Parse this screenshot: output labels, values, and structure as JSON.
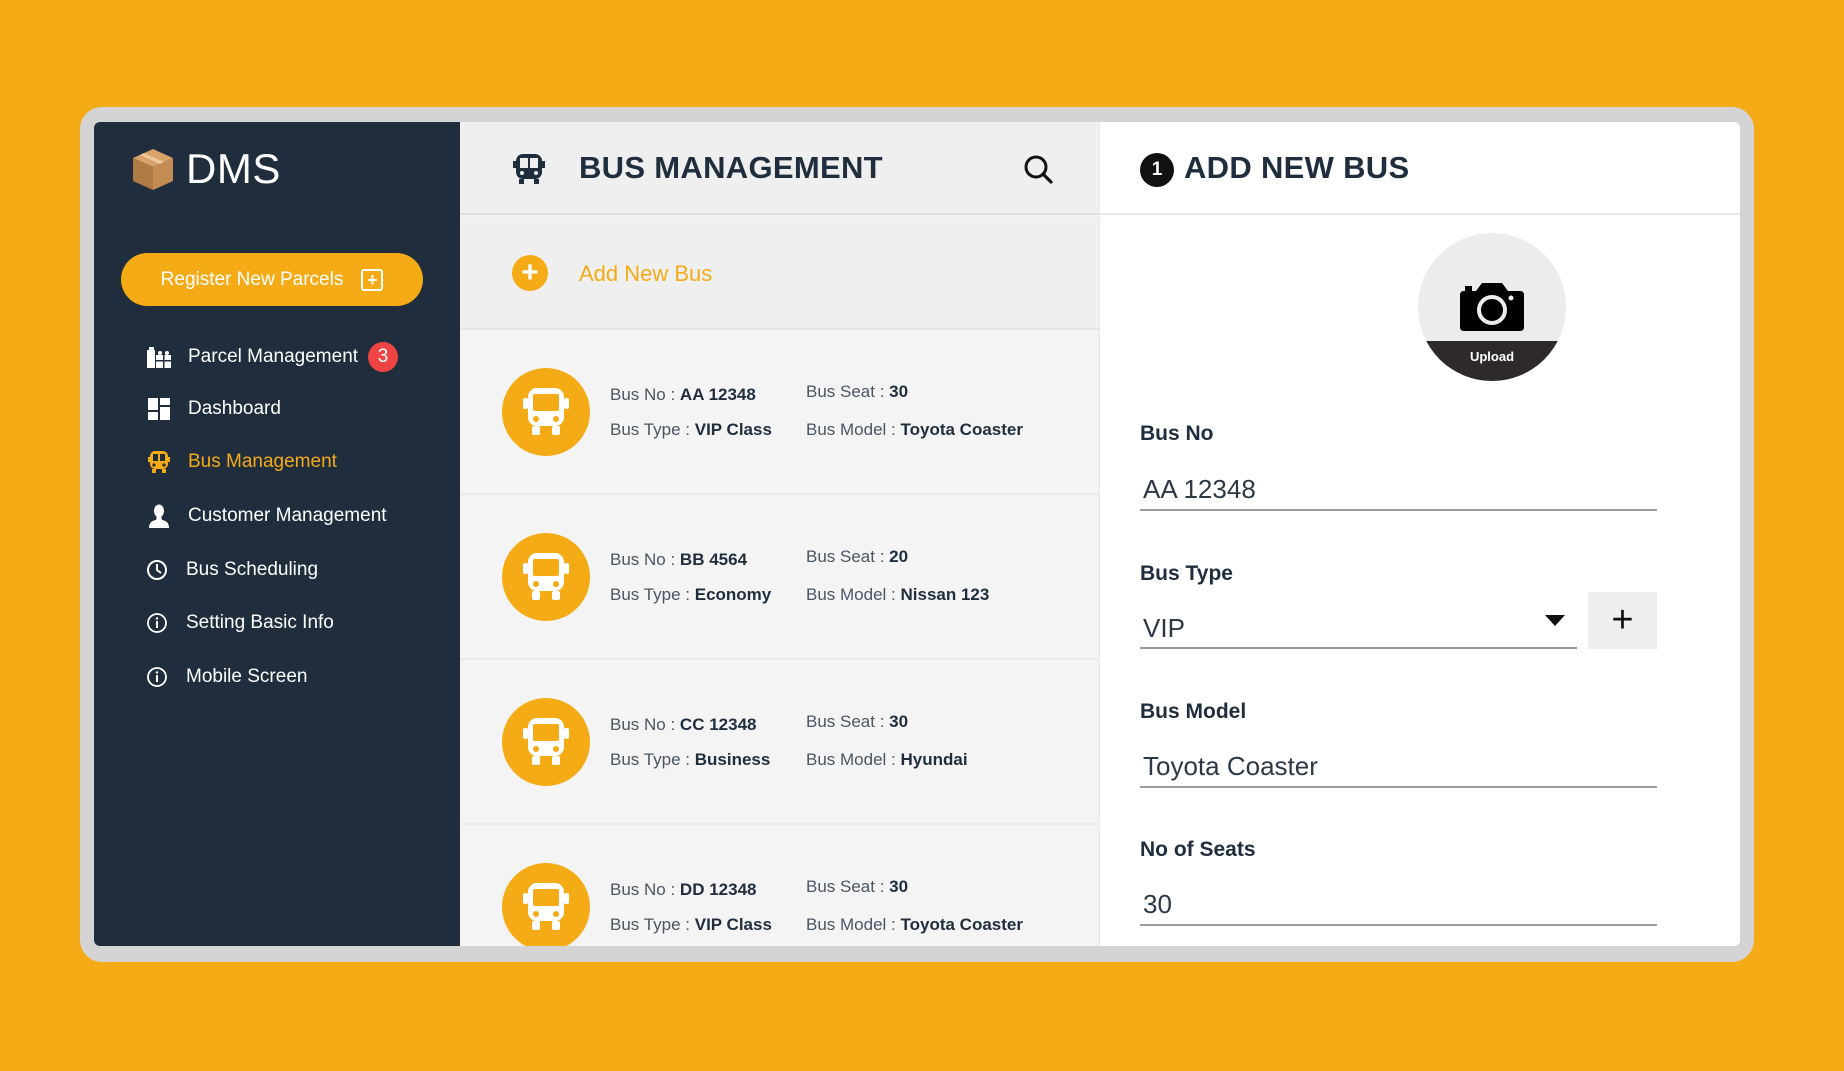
{
  "colors": {
    "accent": "#f5ab16",
    "sidebar_bg": "#1f2d3d",
    "badge": "#ef4444",
    "heading": "#1f2d3d"
  },
  "sidebar": {
    "logo_icon": "package-box-icon",
    "logo_text": "DMS",
    "register_button": {
      "label": "Register New Parcels",
      "icon": "plus-square-icon"
    },
    "items": [
      {
        "label": "Parcel Management",
        "icon": "parcel-icon",
        "badge": "3",
        "active": false
      },
      {
        "label": "Dashboard",
        "icon": "dashboard-icon",
        "active": false
      },
      {
        "label": "Bus Management",
        "icon": "bus-icon",
        "active": true
      },
      {
        "label": "Customer Management",
        "icon": "user-icon",
        "active": false
      },
      {
        "label": "Bus Scheduling",
        "icon": "clock-icon",
        "active": false
      },
      {
        "label": "Setting Basic Info",
        "icon": "info-icon",
        "active": false
      },
      {
        "label": "Mobile Screen",
        "icon": "info-icon",
        "active": false
      }
    ]
  },
  "middle": {
    "header": {
      "title": "BUS MANAGEMENT",
      "icon": "bus-icon",
      "search_icon": "search-icon"
    },
    "add_new": {
      "label": "Add New Bus",
      "icon": "plus-circle-icon"
    },
    "field_labels": {
      "bus_no": "Bus No : ",
      "bus_type": "Bus Type : ",
      "bus_seat": "Bus Seat : ",
      "bus_model": "Bus Model : "
    },
    "buses": [
      {
        "bus_no": "AA 12348",
        "bus_type": "VIP Class",
        "bus_seat": "30",
        "bus_model": "Toyota Coaster"
      },
      {
        "bus_no": "BB 4564",
        "bus_type": "Economy",
        "bus_seat": "20",
        "bus_model": "Nissan 123"
      },
      {
        "bus_no": "CC 12348",
        "bus_type": "Business",
        "bus_seat": "30",
        "bus_model": "Hyundai"
      },
      {
        "bus_no": "DD 12348",
        "bus_type": "VIP Class",
        "bus_seat": "30",
        "bus_model": "Toyota Coaster"
      }
    ]
  },
  "form": {
    "step": "1",
    "title": "ADD NEW BUS",
    "upload_label": "Upload",
    "fields": {
      "bus_no": {
        "label": "Bus No",
        "value": "AA 12348"
      },
      "bus_type": {
        "label": "Bus Type",
        "value": "VIP",
        "add_button": "+"
      },
      "bus_model": {
        "label": "Bus Model",
        "value": "Toyota Coaster"
      },
      "seats": {
        "label": "No of Seats",
        "value": "30"
      }
    }
  }
}
